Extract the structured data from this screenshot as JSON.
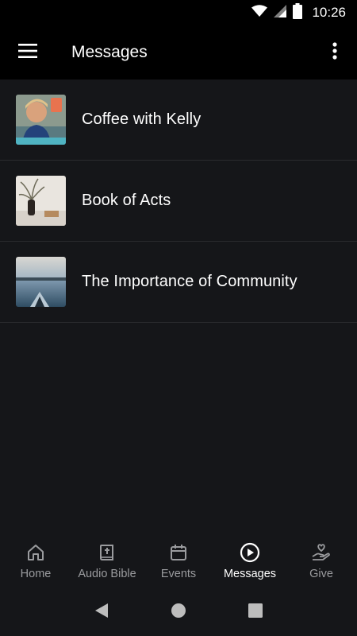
{
  "status_bar": {
    "time": "10:26"
  },
  "app_bar": {
    "title": "Messages"
  },
  "messages": [
    {
      "title": "Coffee with Kelly",
      "thumbnail": "coffee-with-kelly-thumbnail"
    },
    {
      "title": "Book of Acts",
      "thumbnail": "book-of-acts-thumbnail"
    },
    {
      "title": "The Importance of Community",
      "thumbnail": "community-thumbnail"
    }
  ],
  "bottom_nav": [
    {
      "label": "Home",
      "icon": "home-icon",
      "active": false
    },
    {
      "label": "Audio Bible",
      "icon": "bible-icon",
      "active": false
    },
    {
      "label": "Events",
      "icon": "calendar-icon",
      "active": false
    },
    {
      "label": "Messages",
      "icon": "play-circle-icon",
      "active": true
    },
    {
      "label": "Give",
      "icon": "give-hand-heart-icon",
      "active": false
    }
  ],
  "colors": {
    "background": "#151619",
    "bar": "#000000",
    "inactive": "#9a9b9e",
    "active": "#ffffff"
  }
}
